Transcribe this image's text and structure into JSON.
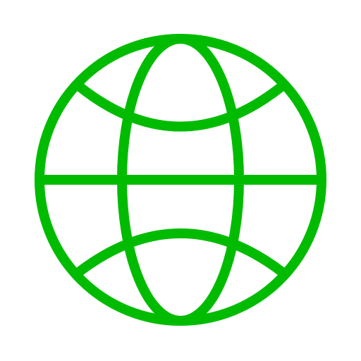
{
  "icon": {
    "name": "globe-icon",
    "color": "#00bb00",
    "background": "#ffffff"
  }
}
